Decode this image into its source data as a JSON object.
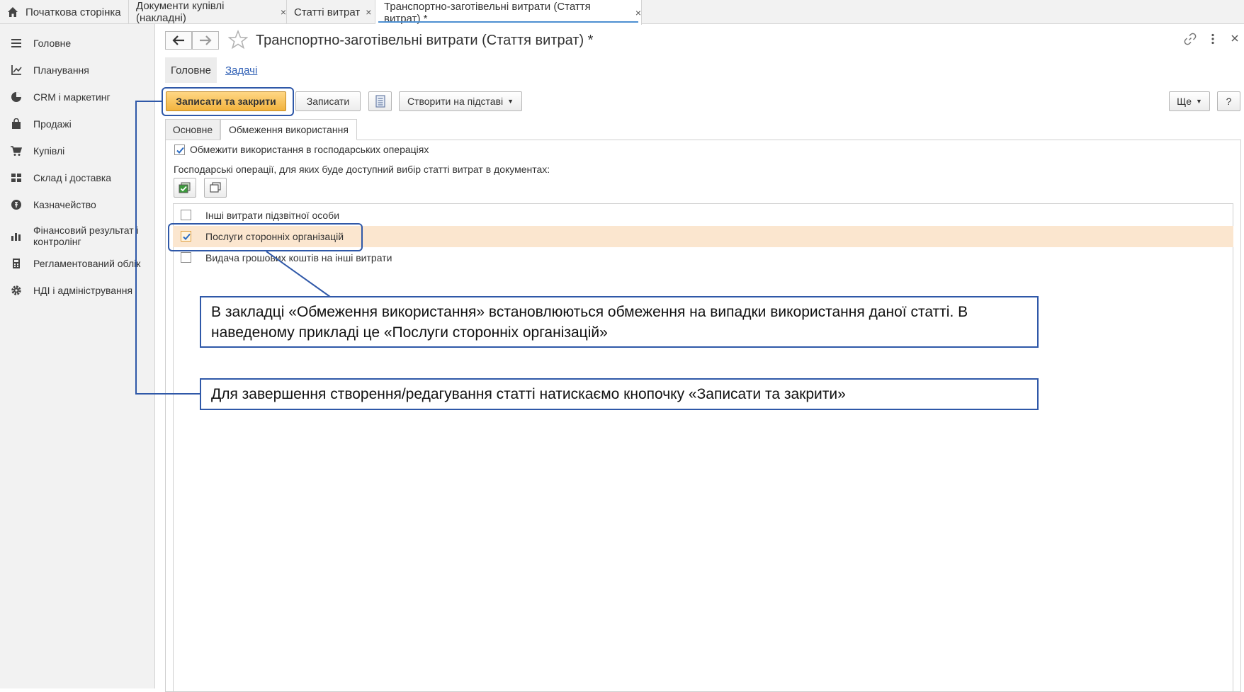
{
  "tabs": [
    {
      "label": "Початкова сторінка",
      "closable": false
    },
    {
      "label": "Документи купівлі (накладні)",
      "closable": true
    },
    {
      "label": "Статті витрат",
      "closable": true
    },
    {
      "label": "Транспортно-заготівельні витрати (Стаття витрат) *",
      "closable": true,
      "active": true
    }
  ],
  "tab_close_symbol": "×",
  "sidebar": {
    "items": [
      {
        "label": "Головне",
        "icon": "menu-lines-icon"
      },
      {
        "label": "Планування",
        "icon": "chart-axes-icon"
      },
      {
        "label": "CRM і маркетинг",
        "icon": "pie-chart-icon"
      },
      {
        "label": "Продажі",
        "icon": "shopping-bag-icon"
      },
      {
        "label": "Купівлі",
        "icon": "cart-icon"
      },
      {
        "label": "Склад і доставка",
        "icon": "grid-icon"
      },
      {
        "label": "Казначейство",
        "icon": "coin-icon"
      },
      {
        "label": "Фінансовий результат і контролінг",
        "icon": "bar-chart-icon"
      },
      {
        "label": "Регламентований облік",
        "icon": "calculator-icon"
      },
      {
        "label": "НДІ і адміністрування",
        "icon": "gear-icon"
      }
    ]
  },
  "form": {
    "title": "Транспортно-заготівельні витрати (Стаття витрат) *",
    "subnav": {
      "home": "Головне",
      "tasks": "Задачі"
    },
    "toolbar": {
      "save_close": "Записати та закрити",
      "save": "Записати",
      "create_based": "Створити на підставі",
      "more": "Ще",
      "help": "?"
    },
    "inner_tabs": [
      "Основне",
      "Обмеження використання"
    ],
    "restrict_checkbox": {
      "label": "Обмежити використання в господарських операціях",
      "checked": true
    },
    "operations_caption": "Господарські операції, для яких буде доступний вибір статті витрат в документах:",
    "operations": [
      {
        "label": "Інші витрати підзвітної особи",
        "checked": false
      },
      {
        "label": "Послуги сторонніх організацій",
        "checked": true,
        "selected": true
      },
      {
        "label": "Видача грошових коштів на інші витрати",
        "checked": false
      }
    ]
  },
  "callouts": {
    "restriction": "В закладці «Обмеження використання» встановлюються обмеження на випадки використання даної статті. В наведеному прикладі це «Послуги сторонніх організацій»",
    "finish": "Для завершення створення/редагування статті натискаємо кнопочку «Записати та закрити»"
  },
  "colors": {
    "accent": "#4d8fd1",
    "primary_button": "#f2b33e",
    "selected_row": "#fbe6cf",
    "callout_border": "#2f58a8",
    "link": "#2f5fb5"
  }
}
